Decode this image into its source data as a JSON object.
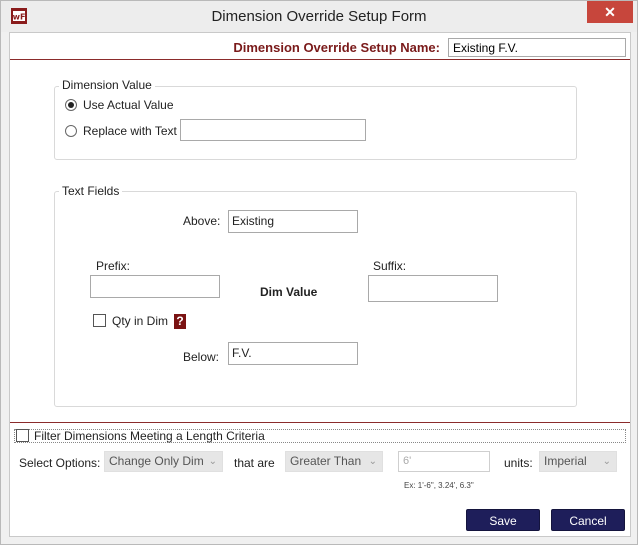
{
  "window": {
    "title": "Dimension Override Setup Form",
    "close_glyph": "✕",
    "icon": "app-logo-icon"
  },
  "header": {
    "name_label": "Dimension Override Setup Name:",
    "name_value": "Existing F.V."
  },
  "dimension_value": {
    "group_title": "Dimension Value",
    "use_actual_label": "Use Actual Value",
    "use_actual_selected": true,
    "replace_label": "Replace with Text",
    "replace_selected": false,
    "replace_value": ""
  },
  "text_fields": {
    "group_title": "Text Fields",
    "above_label": "Above:",
    "above_value": "Existing",
    "prefix_label": "Prefix:",
    "prefix_value": "",
    "dim_value_label": "Dim Value",
    "suffix_label": "Suffix:",
    "suffix_value": "",
    "qty_label": "Qty in Dim",
    "qty_checked": false,
    "help_glyph": "?",
    "below_label": "Below:",
    "below_value": "F.V."
  },
  "filter": {
    "checkbox_label": "Filter Dimensions Meeting a Length Criteria",
    "checked": false,
    "select_options_label": "Select Options:",
    "option_value": "Change Only Dim",
    "that_are_label": "that are",
    "comparison_value": "Greater Than",
    "length_value": "6'",
    "example_text": "Ex: 1'-6\", 3.24', 6.3\"",
    "units_label": "units:",
    "units_value": "Imperial"
  },
  "footer": {
    "save_label": "Save",
    "cancel_label": "Cancel"
  },
  "colors": {
    "accent_red": "#7a1a1a",
    "button_navy": "#1e1e5a",
    "close_red": "#c7463c"
  }
}
